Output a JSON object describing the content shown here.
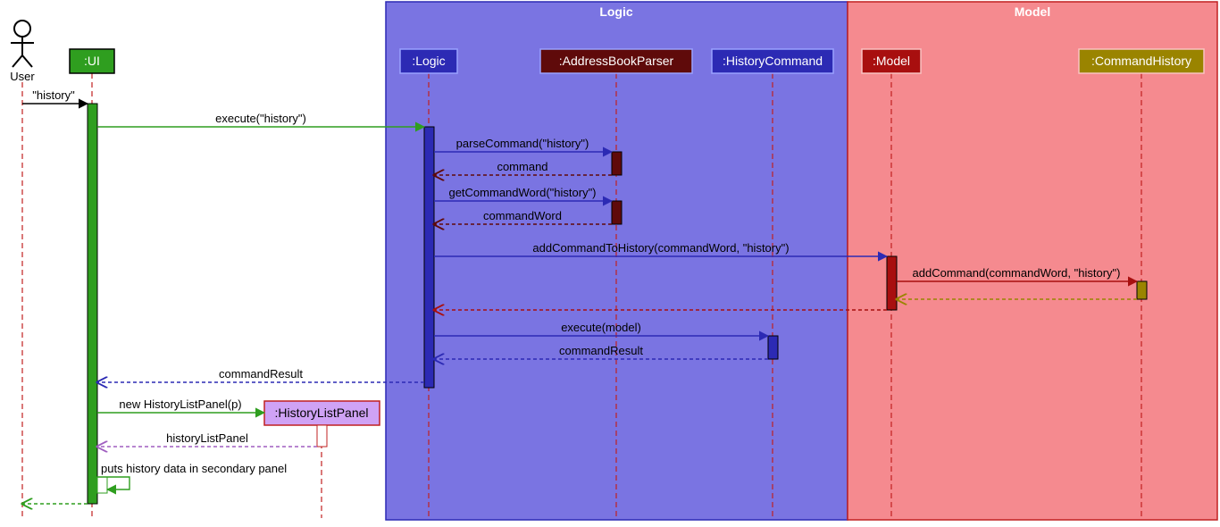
{
  "regions": {
    "logic": {
      "title": "Logic",
      "fill": "#7a74e2",
      "stroke": "#2c2ab4"
    },
    "model": {
      "title": "Model",
      "fill": "#f58a8f",
      "stroke": "#c02020"
    }
  },
  "actors": {
    "user": {
      "label": "User"
    }
  },
  "participants": {
    "ui": {
      "label": ":UI",
      "fill": "#2f9e1f",
      "textFill": "#ffffff",
      "border": "#000000"
    },
    "logic": {
      "label": ":Logic",
      "fill": "#2c2ab4",
      "textFill": "#ffffff",
      "border": "#9aa1ff"
    },
    "parser": {
      "label": ":AddressBookParser",
      "fill": "#5f0a0a",
      "textFill": "#ffffff",
      "border": "#9aa1ff"
    },
    "historyCmd": {
      "label": ":HistoryCommand",
      "fill": "#2c2ab4",
      "textFill": "#ffffff",
      "border": "#9aa1ff"
    },
    "model": {
      "label": ":Model",
      "fill": "#a80f0f",
      "textFill": "#ffffff",
      "border": "#f9c2c2"
    },
    "cmdHistory": {
      "label": ":CommandHistory",
      "fill": "#9a8400",
      "textFill": "#ffffff",
      "border": "#f9c2c2"
    },
    "historyListPanel": {
      "label": ":HistoryListPanel",
      "fill": "#cfa2f5",
      "textFill": "#000000",
      "border": "#c02020"
    }
  },
  "messages": {
    "m1": "\"history\"",
    "m2": "execute(\"history\")",
    "m3": "parseCommand(\"history\")",
    "m4": "command",
    "m5": "getCommandWord(\"history\")",
    "m6": "commandWord",
    "m7": "addCommandToHistory(commandWord, \"history\")",
    "m8": "addCommand(commandWord, \"history\")",
    "m9": "execute(model)",
    "m10": "commandResult",
    "m11": "commandResult",
    "m12": "new HistoryListPanel(p)",
    "m13": "historyListPanel",
    "m14": "puts history data in secondary panel"
  },
  "chart_data": {
    "type": "sequence-diagram",
    "participants": [
      {
        "name": "User",
        "kind": "actor",
        "group": null
      },
      {
        "name": ":UI",
        "kind": "object",
        "group": null
      },
      {
        "name": ":Logic",
        "kind": "object",
        "group": "Logic"
      },
      {
        "name": ":AddressBookParser",
        "kind": "object",
        "group": "Logic"
      },
      {
        "name": ":HistoryCommand",
        "kind": "object",
        "group": "Logic"
      },
      {
        "name": ":Model",
        "kind": "object",
        "group": "Model"
      },
      {
        "name": ":CommandHistory",
        "kind": "object",
        "group": "Model"
      },
      {
        "name": ":HistoryListPanel",
        "kind": "object",
        "group": null,
        "created_dynamically": true
      }
    ],
    "groups": [
      {
        "name": "Logic",
        "color": "#7a74e2"
      },
      {
        "name": "Model",
        "color": "#f58a8f"
      }
    ],
    "messages": [
      {
        "from": "User",
        "to": ":UI",
        "label": "\"history\"",
        "style": "sync",
        "direction": "forward"
      },
      {
        "from": ":UI",
        "to": ":Logic",
        "label": "execute(\"history\")",
        "style": "sync",
        "direction": "forward"
      },
      {
        "from": ":Logic",
        "to": ":AddressBookParser",
        "label": "parseCommand(\"history\")",
        "style": "sync",
        "direction": "forward"
      },
      {
        "from": ":AddressBookParser",
        "to": ":Logic",
        "label": "command",
        "style": "return",
        "direction": "back"
      },
      {
        "from": ":Logic",
        "to": ":AddressBookParser",
        "label": "getCommandWord(\"history\")",
        "style": "sync",
        "direction": "forward"
      },
      {
        "from": ":AddressBookParser",
        "to": ":Logic",
        "label": "commandWord",
        "style": "return",
        "direction": "back"
      },
      {
        "from": ":Logic",
        "to": ":Model",
        "label": "addCommandToHistory(commandWord, \"history\")",
        "style": "sync",
        "direction": "forward"
      },
      {
        "from": ":Model",
        "to": ":CommandHistory",
        "label": "addCommand(commandWord, \"history\")",
        "style": "sync",
        "direction": "forward"
      },
      {
        "from": ":CommandHistory",
        "to": ":Model",
        "label": "",
        "style": "return",
        "direction": "back"
      },
      {
        "from": ":Model",
        "to": ":Logic",
        "label": "",
        "style": "return",
        "direction": "back"
      },
      {
        "from": ":Logic",
        "to": ":HistoryCommand",
        "label": "execute(model)",
        "style": "sync",
        "direction": "forward"
      },
      {
        "from": ":HistoryCommand",
        "to": ":Logic",
        "label": "commandResult",
        "style": "return",
        "direction": "back"
      },
      {
        "from": ":Logic",
        "to": ":UI",
        "label": "commandResult",
        "style": "return",
        "direction": "back"
      },
      {
        "from": ":UI",
        "to": ":HistoryListPanel",
        "label": "new HistoryListPanel(p)",
        "style": "create",
        "direction": "forward"
      },
      {
        "from": ":HistoryListPanel",
        "to": ":UI",
        "label": "historyListPanel",
        "style": "return",
        "direction": "back"
      },
      {
        "from": ":UI",
        "to": ":UI",
        "label": "puts history data in secondary panel",
        "style": "self",
        "direction": "forward"
      },
      {
        "from": ":UI",
        "to": "User",
        "label": "",
        "style": "return",
        "direction": "back"
      }
    ]
  }
}
